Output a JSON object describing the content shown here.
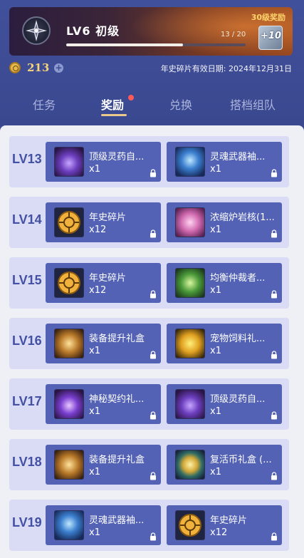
{
  "header": {
    "level_title": "LV6 初级",
    "progress_text": "13 / 20",
    "progress_fraction": 0.65,
    "level30_reward": "30级奖励",
    "chest_label": "+10"
  },
  "currency": {
    "amount": "213",
    "add_symbol": "+"
  },
  "expiry_text": "年史碎片有效日期: 2024年12月31日",
  "tabs": [
    {
      "label": "任务"
    },
    {
      "label": "奖励"
    },
    {
      "label": "兑换"
    },
    {
      "label": "搭档组队"
    }
  ],
  "rows": [
    {
      "level": "LV13",
      "items": [
        {
          "name": "顶级灵药自...",
          "qty": "x1",
          "icon": "elixir-chest-icon"
        },
        {
          "name": "灵魂武器袖...",
          "qty": "x1",
          "icon": "soul-orb-icon"
        }
      ]
    },
    {
      "level": "LV14",
      "items": [
        {
          "name": "年史碎片",
          "qty": "x12",
          "icon": "chronicle-shard-icon"
        },
        {
          "name": "浓缩炉岩核(1...",
          "qty": "x1",
          "icon": "furnace-core-icon"
        }
      ]
    },
    {
      "level": "LV15",
      "items": [
        {
          "name": "年史碎片",
          "qty": "x12",
          "icon": "chronicle-shard-icon"
        },
        {
          "name": "均衡仲裁者...",
          "qty": "x1",
          "icon": "arbiter-emblem-icon"
        }
      ]
    },
    {
      "level": "LV16",
      "items": [
        {
          "name": "装备提升礼盒",
          "qty": "x1",
          "icon": "gear-box-icon"
        },
        {
          "name": "宠物饲料礼...",
          "qty": "x1",
          "icon": "pet-food-icon"
        }
      ]
    },
    {
      "level": "LV17",
      "items": [
        {
          "name": "神秘契约礼...",
          "qty": "x1",
          "icon": "mystic-bag-icon"
        },
        {
          "name": "顶级灵药自...",
          "qty": "x1",
          "icon": "elixir-chest-icon"
        }
      ]
    },
    {
      "level": "LV18",
      "items": [
        {
          "name": "装备提升礼盒",
          "qty": "x1",
          "icon": "gear-box-icon"
        },
        {
          "name": "复活币礼盒 (...",
          "qty": "x1",
          "icon": "revive-coin-icon"
        }
      ]
    },
    {
      "level": "LV19",
      "items": [
        {
          "name": "灵魂武器袖...",
          "qty": "x1",
          "icon": "soul-orb-icon"
        },
        {
          "name": "年史碎片",
          "qty": "x12",
          "icon": "chronicle-shard-icon"
        }
      ]
    }
  ],
  "colors": {
    "background": "#3b4a92",
    "card": "#5362b5",
    "row": "#d9dcf4",
    "level_text": "#4350a3",
    "accent_gold": "#eac98b",
    "notify_dot": "#ff5a5a"
  }
}
